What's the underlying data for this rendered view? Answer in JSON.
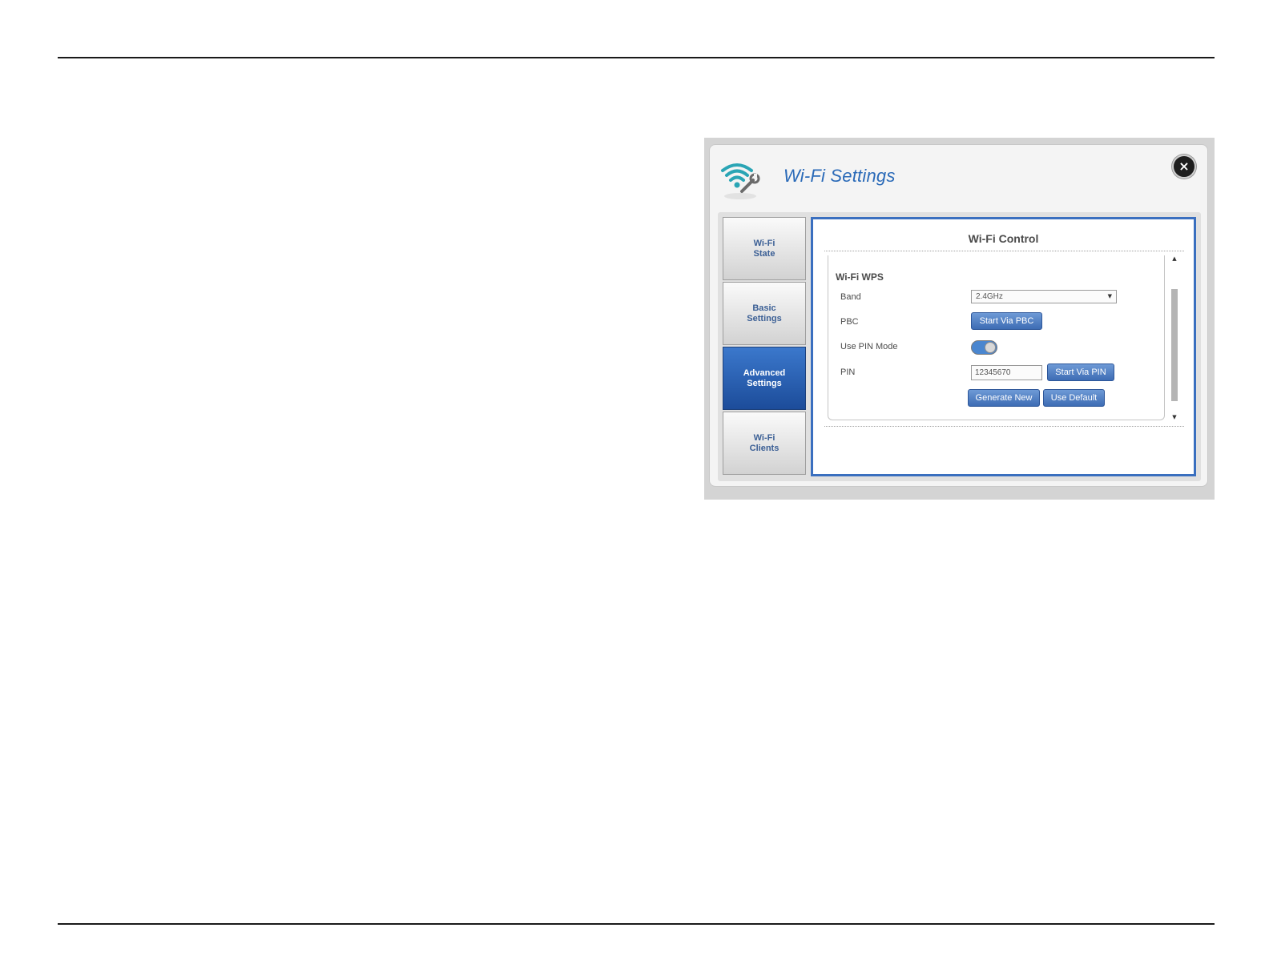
{
  "dialog": {
    "title": "Wi-Fi Settings",
    "close_icon": "×"
  },
  "tabs": [
    {
      "line1": "Wi-Fi",
      "line2": "State"
    },
    {
      "line1": "Basic",
      "line2": "Settings"
    },
    {
      "line1": "Advanced",
      "line2": "Settings"
    },
    {
      "line1": "Wi-Fi",
      "line2": "Clients"
    }
  ],
  "active_tab": "Advanced Settings",
  "panel": {
    "title": "Wi-Fi Control",
    "section_title": "Wi-Fi WPS",
    "band_label": "Band",
    "band_value": "2.4GHz",
    "select_arrow": "▼",
    "pbc_label": "PBC",
    "start_pbc_label": "Start Via PBC",
    "pin_mode_label": "Use PIN Mode",
    "pin_mode_on": true,
    "pin_label": "PIN",
    "pin_value": "12345670",
    "start_pin_label": "Start Via PIN",
    "generate_new_label": "Generate New",
    "use_default_label": "Use Default",
    "scroll_up_icon": "▲",
    "scroll_down_icon": "▼"
  },
  "colors": {
    "accent": "#3a6fbf",
    "title_blue": "#2a6ab8",
    "active_tab": "#2a5fb4"
  }
}
